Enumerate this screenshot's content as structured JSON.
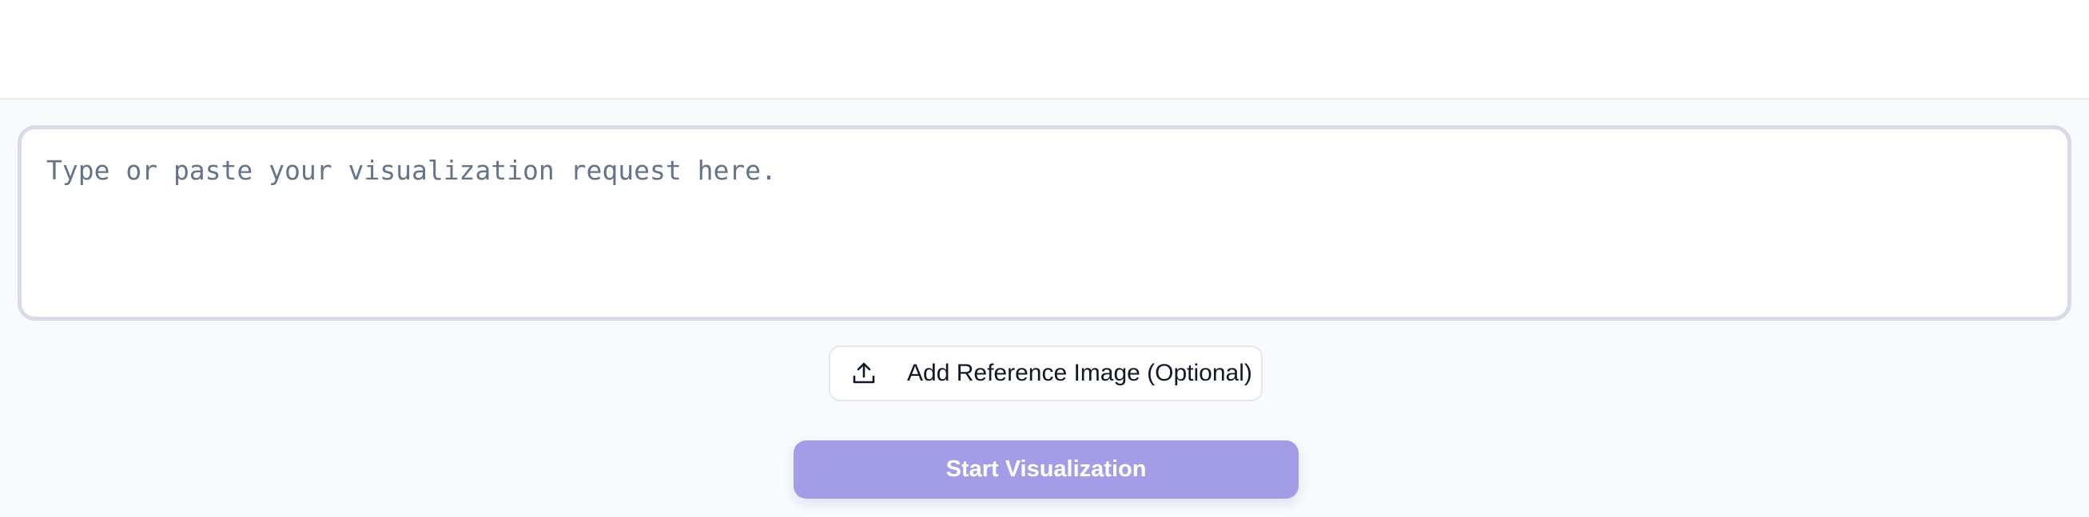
{
  "prompt": {
    "value": "",
    "placeholder": "Type or paste your visualization request here."
  },
  "reference_image": {
    "label": "Add Reference Image (Optional)",
    "icon": "upload-icon"
  },
  "start": {
    "label": "Start Visualization",
    "color": "#a39de8"
  },
  "colors": {
    "page_background": "#f8fafc",
    "input_border": "#d9dae8",
    "placeholder_text": "#64748b"
  }
}
